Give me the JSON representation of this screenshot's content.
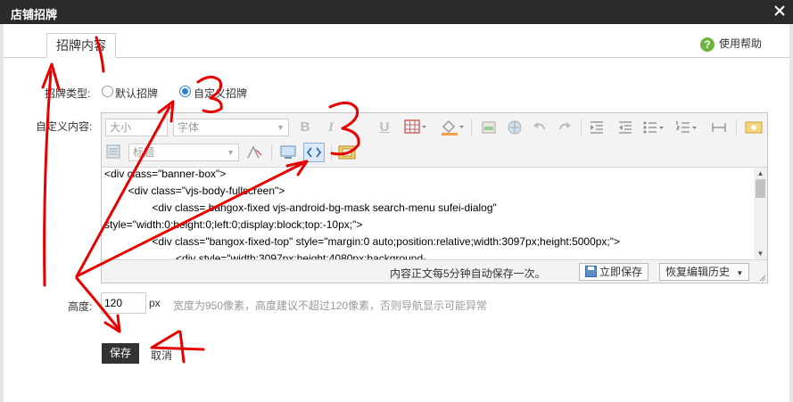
{
  "dialog": {
    "title": "店铺招牌"
  },
  "tab": {
    "label": "招牌内容"
  },
  "help": {
    "label": "使用帮助",
    "icon": "help-circle-icon",
    "icon_glyph": "?"
  },
  "type_field": {
    "label": "招牌类型:",
    "options": [
      {
        "label": "默认招牌",
        "checked": false
      },
      {
        "label": "自定义招牌",
        "checked": true
      }
    ]
  },
  "content_field": {
    "label": "自定义内容:"
  },
  "editor": {
    "toolbar": {
      "size_select": "大小",
      "font_select": "字体",
      "heading_select": "标题",
      "bold": "B",
      "italic": "I",
      "underline": "U"
    },
    "code_lines": [
      "<div class=\"banner-box\">",
      "        <div class=\"vjs-body-fullscreen\">",
      "                <div class= bangox-fixed vjs-android-bg-mask search-menu sufei-dialog\"",
      "style=\"width:0;height:0;left:0;display:block;top:-10px;\">",
      "                <div class=\"bangox-fixed-top\" style=\"margin:0 auto;position:relative;width:3097px;height:5000px;\">",
      "                        <div style=\"width:3097px;height:4080px;background-"
    ],
    "status": {
      "autosave_text": "内容正文每5分钟自动保存一次。",
      "save_now": "立即保存",
      "restore_history": "恢复编辑历史"
    }
  },
  "height_field": {
    "label": "高度:",
    "value": "120",
    "unit": "px",
    "hint": "宽度为950像素，高度建议不超过120像素，否则导航显示可能异常"
  },
  "actions": {
    "save": "保存",
    "cancel": "取消"
  },
  "colors": {
    "titlebar": "#2b2b2b",
    "annotation": "#e60000",
    "selected_radio": "#2a7fd4",
    "save_button": "#333333"
  }
}
